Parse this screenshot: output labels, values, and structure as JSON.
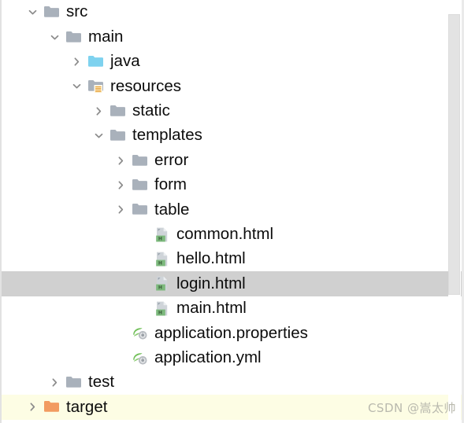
{
  "panel": {
    "name": "project-tree",
    "background": "#ffffff",
    "selected_row_color": "#d0d0d0",
    "highlight_row_color": "#fdfde4"
  },
  "scrollbar": {
    "orientation": "vertical",
    "thumb_color": "#e3e3e3",
    "track_color": "#ffffff"
  },
  "watermark": {
    "text": "CSDN @嵩太帅"
  },
  "tree": {
    "rows": [
      {
        "label": "src",
        "indent": 0,
        "chevron": "down",
        "icon": "folder-gray-icon",
        "state": "normal"
      },
      {
        "label": "main",
        "indent": 1,
        "chevron": "down",
        "icon": "folder-gray-icon",
        "state": "normal"
      },
      {
        "label": "java",
        "indent": 2,
        "chevron": "right",
        "icon": "folder-source-blue-icon",
        "state": "normal"
      },
      {
        "label": "resources",
        "indent": 2,
        "chevron": "down",
        "icon": "folder-resources-icon",
        "state": "normal"
      },
      {
        "label": "static",
        "indent": 3,
        "chevron": "right",
        "icon": "folder-gray-icon",
        "state": "normal"
      },
      {
        "label": "templates",
        "indent": 3,
        "chevron": "down",
        "icon": "folder-gray-icon",
        "state": "normal"
      },
      {
        "label": "error",
        "indent": 4,
        "chevron": "right",
        "icon": "folder-gray-icon",
        "state": "normal"
      },
      {
        "label": "form",
        "indent": 4,
        "chevron": "right",
        "icon": "folder-gray-icon",
        "state": "normal"
      },
      {
        "label": "table",
        "indent": 4,
        "chevron": "right",
        "icon": "folder-gray-icon",
        "state": "normal"
      },
      {
        "label": "common.html",
        "indent": 5,
        "chevron": "none",
        "icon": "file-html-icon",
        "state": "normal"
      },
      {
        "label": "hello.html",
        "indent": 5,
        "chevron": "none",
        "icon": "file-html-icon",
        "state": "normal"
      },
      {
        "label": "login.html",
        "indent": 5,
        "chevron": "none",
        "icon": "file-html-icon",
        "state": "selected"
      },
      {
        "label": "main.html",
        "indent": 5,
        "chevron": "none",
        "icon": "file-html-icon",
        "state": "normal"
      },
      {
        "label": "application.properties",
        "indent": 4,
        "chevron": "none",
        "icon": "file-spring-icon",
        "state": "normal"
      },
      {
        "label": "application.yml",
        "indent": 4,
        "chevron": "none",
        "icon": "file-spring-icon",
        "state": "normal"
      },
      {
        "label": "test",
        "indent": 1,
        "chevron": "right",
        "icon": "folder-gray-icon",
        "state": "normal"
      },
      {
        "label": "target",
        "indent": 0,
        "chevron": "right",
        "icon": "folder-orange-icon",
        "state": "highlight"
      }
    ]
  }
}
